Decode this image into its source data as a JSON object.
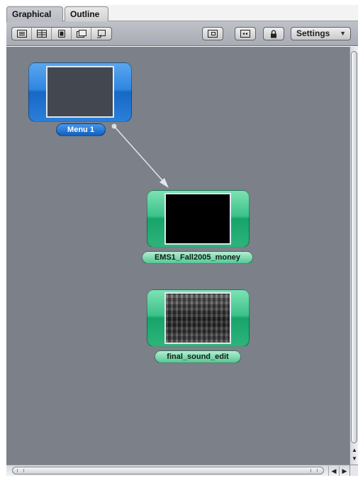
{
  "tabs": [
    {
      "label": "Graphical",
      "active": true
    },
    {
      "label": "Outline",
      "active": false
    }
  ],
  "toolbar": {
    "left_group_icons": [
      "add-menu-icon",
      "add-layered-menu-icon",
      "add-track-icon",
      "add-slideshow-icon",
      "add-script-icon"
    ],
    "right_icons": [
      "zoom-fit-icon",
      "arrange-icon",
      "lock-icon"
    ],
    "settings_label": "Settings"
  },
  "canvas": {
    "background_color": "#7b8089",
    "nodes": [
      {
        "label": "Menu 1",
        "kind": "menu",
        "color": "#2f86e0"
      },
      {
        "label": "EMS1_Fall2005_money",
        "kind": "track",
        "color": "#3cc18a"
      },
      {
        "label": "final_sound_edit",
        "kind": "track",
        "color": "#3cc18a"
      }
    ],
    "connection": {
      "from": "Menu 1",
      "to": "EMS1_Fall2005_money"
    }
  },
  "colors": {
    "menu_tile": "#2f86e0",
    "track_tile": "#3cc18a",
    "canvas": "#7b8089"
  }
}
